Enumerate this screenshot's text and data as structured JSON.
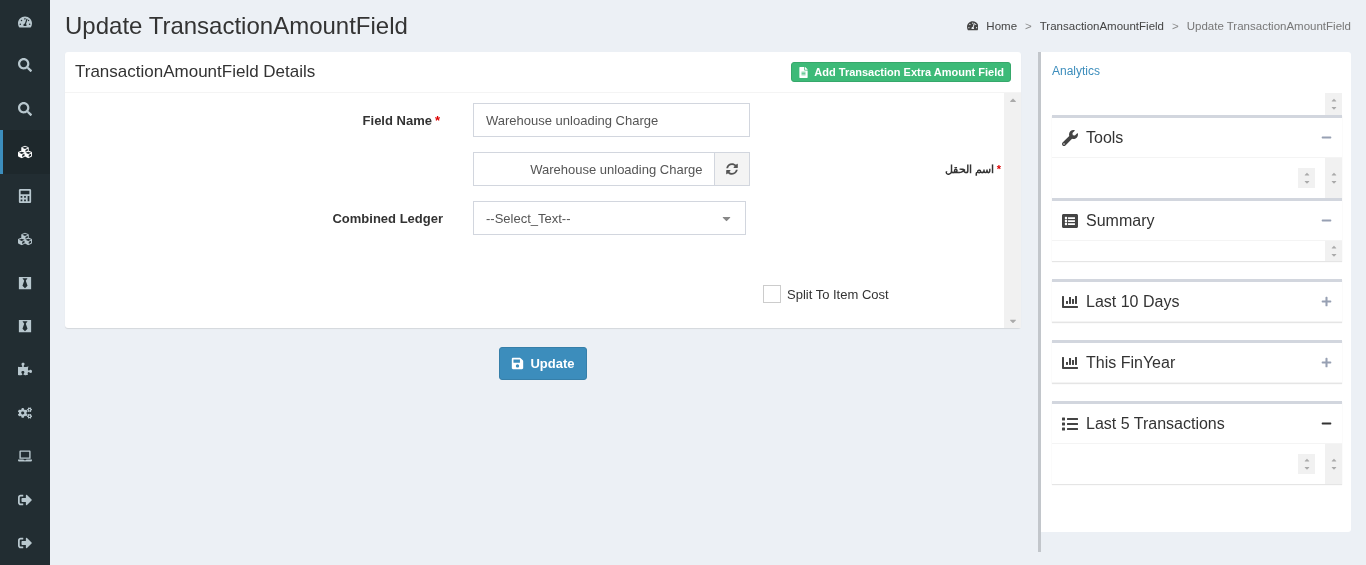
{
  "sidebar": {
    "items": [
      {
        "kind": "dashboard",
        "selected": false
      },
      {
        "kind": "search",
        "selected": false
      },
      {
        "kind": "search",
        "selected": false
      },
      {
        "kind": "cubes",
        "selected": true
      },
      {
        "kind": "calculator",
        "selected": false
      },
      {
        "kind": "cubes",
        "selected": false
      },
      {
        "kind": "tie",
        "selected": false
      },
      {
        "kind": "tie",
        "selected": false
      },
      {
        "kind": "puzzle",
        "selected": false
      },
      {
        "kind": "cogs",
        "selected": false
      },
      {
        "kind": "laptop",
        "selected": false
      },
      {
        "kind": "signout",
        "selected": false
      },
      {
        "kind": "signout",
        "selected": false
      }
    ]
  },
  "page_title": "Update TransactionAmountField",
  "breadcrumb": {
    "separator": ">",
    "items": [
      "Home",
      "TransactionAmountField",
      "Update TransactionAmountField"
    ]
  },
  "details": {
    "title": "TransactionAmountField Details",
    "add_button": "Add Transaction Extra Amount Field",
    "field_name": {
      "label": "Field Name",
      "required_mark": "*",
      "value": "Warehouse unloading Charge"
    },
    "arabic_name": {
      "label": "اسم الحقل",
      "required_mark": "*",
      "value": "Warehouse unloading Charge"
    },
    "combined_ledger": {
      "label": "Combined Ledger",
      "value": "--Select_Text--"
    },
    "split_to_item_cost": {
      "label": "Split To Item Cost",
      "checked": false
    }
  },
  "update_button": "Update",
  "analytics": {
    "title": "Analytics",
    "widgets": [
      {
        "kind": "tools",
        "title": "Tools",
        "expanded": true
      },
      {
        "kind": "summary",
        "title": "Summary",
        "expanded": true
      },
      {
        "kind": "chart",
        "title": "Last 10 Days",
        "expanded": false
      },
      {
        "kind": "chart",
        "title": "This FinYear",
        "expanded": false
      },
      {
        "kind": "list",
        "title": "Last 5 Transactions",
        "expanded": true
      }
    ]
  }
}
